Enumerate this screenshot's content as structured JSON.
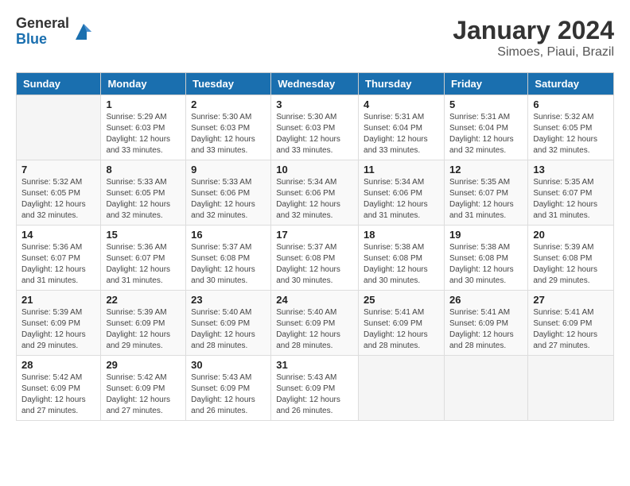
{
  "logo": {
    "general": "General",
    "blue": "Blue"
  },
  "title": "January 2024",
  "subtitle": "Simoes, Piaui, Brazil",
  "days_header": [
    "Sunday",
    "Monday",
    "Tuesday",
    "Wednesday",
    "Thursday",
    "Friday",
    "Saturday"
  ],
  "weeks": [
    [
      {
        "day": "",
        "info": ""
      },
      {
        "day": "1",
        "info": "Sunrise: 5:29 AM\nSunset: 6:03 PM\nDaylight: 12 hours\nand 33 minutes."
      },
      {
        "day": "2",
        "info": "Sunrise: 5:30 AM\nSunset: 6:03 PM\nDaylight: 12 hours\nand 33 minutes."
      },
      {
        "day": "3",
        "info": "Sunrise: 5:30 AM\nSunset: 6:03 PM\nDaylight: 12 hours\nand 33 minutes."
      },
      {
        "day": "4",
        "info": "Sunrise: 5:31 AM\nSunset: 6:04 PM\nDaylight: 12 hours\nand 33 minutes."
      },
      {
        "day": "5",
        "info": "Sunrise: 5:31 AM\nSunset: 6:04 PM\nDaylight: 12 hours\nand 32 minutes."
      },
      {
        "day": "6",
        "info": "Sunrise: 5:32 AM\nSunset: 6:05 PM\nDaylight: 12 hours\nand 32 minutes."
      }
    ],
    [
      {
        "day": "7",
        "info": "Sunrise: 5:32 AM\nSunset: 6:05 PM\nDaylight: 12 hours\nand 32 minutes."
      },
      {
        "day": "8",
        "info": "Sunrise: 5:33 AM\nSunset: 6:05 PM\nDaylight: 12 hours\nand 32 minutes."
      },
      {
        "day": "9",
        "info": "Sunrise: 5:33 AM\nSunset: 6:06 PM\nDaylight: 12 hours\nand 32 minutes."
      },
      {
        "day": "10",
        "info": "Sunrise: 5:34 AM\nSunset: 6:06 PM\nDaylight: 12 hours\nand 32 minutes."
      },
      {
        "day": "11",
        "info": "Sunrise: 5:34 AM\nSunset: 6:06 PM\nDaylight: 12 hours\nand 31 minutes."
      },
      {
        "day": "12",
        "info": "Sunrise: 5:35 AM\nSunset: 6:07 PM\nDaylight: 12 hours\nand 31 minutes."
      },
      {
        "day": "13",
        "info": "Sunrise: 5:35 AM\nSunset: 6:07 PM\nDaylight: 12 hours\nand 31 minutes."
      }
    ],
    [
      {
        "day": "14",
        "info": "Sunrise: 5:36 AM\nSunset: 6:07 PM\nDaylight: 12 hours\nand 31 minutes."
      },
      {
        "day": "15",
        "info": "Sunrise: 5:36 AM\nSunset: 6:07 PM\nDaylight: 12 hours\nand 31 minutes."
      },
      {
        "day": "16",
        "info": "Sunrise: 5:37 AM\nSunset: 6:08 PM\nDaylight: 12 hours\nand 30 minutes."
      },
      {
        "day": "17",
        "info": "Sunrise: 5:37 AM\nSunset: 6:08 PM\nDaylight: 12 hours\nand 30 minutes."
      },
      {
        "day": "18",
        "info": "Sunrise: 5:38 AM\nSunset: 6:08 PM\nDaylight: 12 hours\nand 30 minutes."
      },
      {
        "day": "19",
        "info": "Sunrise: 5:38 AM\nSunset: 6:08 PM\nDaylight: 12 hours\nand 30 minutes."
      },
      {
        "day": "20",
        "info": "Sunrise: 5:39 AM\nSunset: 6:08 PM\nDaylight: 12 hours\nand 29 minutes."
      }
    ],
    [
      {
        "day": "21",
        "info": "Sunrise: 5:39 AM\nSunset: 6:09 PM\nDaylight: 12 hours\nand 29 minutes."
      },
      {
        "day": "22",
        "info": "Sunrise: 5:39 AM\nSunset: 6:09 PM\nDaylight: 12 hours\nand 29 minutes."
      },
      {
        "day": "23",
        "info": "Sunrise: 5:40 AM\nSunset: 6:09 PM\nDaylight: 12 hours\nand 28 minutes."
      },
      {
        "day": "24",
        "info": "Sunrise: 5:40 AM\nSunset: 6:09 PM\nDaylight: 12 hours\nand 28 minutes."
      },
      {
        "day": "25",
        "info": "Sunrise: 5:41 AM\nSunset: 6:09 PM\nDaylight: 12 hours\nand 28 minutes."
      },
      {
        "day": "26",
        "info": "Sunrise: 5:41 AM\nSunset: 6:09 PM\nDaylight: 12 hours\nand 28 minutes."
      },
      {
        "day": "27",
        "info": "Sunrise: 5:41 AM\nSunset: 6:09 PM\nDaylight: 12 hours\nand 27 minutes."
      }
    ],
    [
      {
        "day": "28",
        "info": "Sunrise: 5:42 AM\nSunset: 6:09 PM\nDaylight: 12 hours\nand 27 minutes."
      },
      {
        "day": "29",
        "info": "Sunrise: 5:42 AM\nSunset: 6:09 PM\nDaylight: 12 hours\nand 27 minutes."
      },
      {
        "day": "30",
        "info": "Sunrise: 5:43 AM\nSunset: 6:09 PM\nDaylight: 12 hours\nand 26 minutes."
      },
      {
        "day": "31",
        "info": "Sunrise: 5:43 AM\nSunset: 6:09 PM\nDaylight: 12 hours\nand 26 minutes."
      },
      {
        "day": "",
        "info": ""
      },
      {
        "day": "",
        "info": ""
      },
      {
        "day": "",
        "info": ""
      }
    ]
  ]
}
